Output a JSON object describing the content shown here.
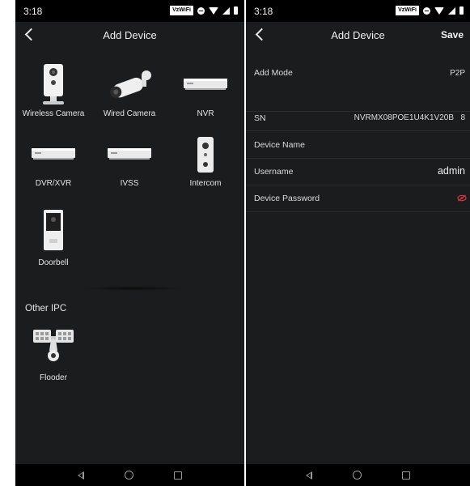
{
  "status_bar": {
    "time": "3:18",
    "wifi_tag": "VzWiFi"
  },
  "left": {
    "title": "Add Device",
    "devices": [
      {
        "label": "Wireless Camera",
        "icon": "wireless-camera-icon"
      },
      {
        "label": "Wired Camera",
        "icon": "wired-camera-icon"
      },
      {
        "label": "NVR",
        "icon": "nvr-icon"
      },
      {
        "label": "DVR/XVR",
        "icon": "dvr-icon"
      },
      {
        "label": "IVSS",
        "icon": "ivss-icon"
      },
      {
        "label": "Intercom",
        "icon": "intercom-icon"
      },
      {
        "label": "Doorbell",
        "icon": "doorbell-icon"
      }
    ],
    "other_section": "Other IPC",
    "other_devices": [
      {
        "label": "Flooder",
        "icon": "floodlight-camera-icon"
      }
    ]
  },
  "right": {
    "title": "Add Device",
    "save_label": "Save",
    "fields": {
      "add_mode": {
        "label": "Add Mode",
        "value": "P2P"
      },
      "sn": {
        "label": "SN",
        "value": "NVRMX08POE1U4K1V20B"
      },
      "device_name": {
        "label": "Device Name",
        "value": ""
      },
      "username": {
        "label": "Username",
        "value": "admin"
      },
      "device_password": {
        "label": "Device Password",
        "value": ""
      }
    },
    "sn_scan_digit": "8"
  },
  "colors": {
    "app_bg": "#1b1c1d",
    "bar_bg": "#000000",
    "text": "#e8e8e8",
    "eye_icon": "#d03a3a"
  }
}
